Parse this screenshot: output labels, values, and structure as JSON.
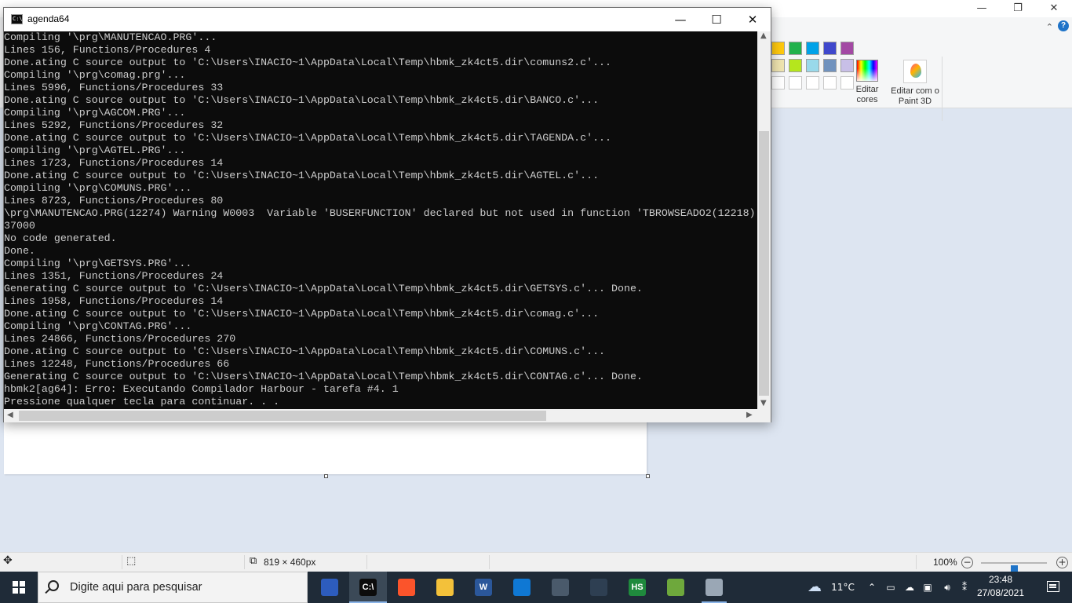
{
  "console": {
    "title": "agenda64",
    "lines": [
      "Compiling '\\prg\\MANUTENCAO.PRG'...",
      "Lines 156, Functions/Procedures 4",
      "Done.ating C source output to 'C:\\Users\\INACIO~1\\AppData\\Local\\Temp\\hbmk_zk4ct5.dir\\comuns2.c'...",
      "Compiling '\\prg\\comag.prg'...",
      "Lines 5996, Functions/Procedures 33",
      "Done.ating C source output to 'C:\\Users\\INACIO~1\\AppData\\Local\\Temp\\hbmk_zk4ct5.dir\\BANCO.c'...",
      "Compiling '\\prg\\AGCOM.PRG'...",
      "Lines 5292, Functions/Procedures 32",
      "Done.ating C source output to 'C:\\Users\\INACIO~1\\AppData\\Local\\Temp\\hbmk_zk4ct5.dir\\TAGENDA.c'...",
      "Compiling '\\prg\\AGTEL.PRG'...",
      "Lines 1723, Functions/Procedures 14",
      "Done.ating C source output to 'C:\\Users\\INACIO~1\\AppData\\Local\\Temp\\hbmk_zk4ct5.dir\\AGTEL.c'...",
      "Compiling '\\prg\\COMUNS.PRG'...",
      "Lines 8723, Functions/Procedures 80",
      "\\prg\\MANUTENCAO.PRG(12274) Warning W0003  Variable 'BUSERFUNCTION' declared but not used in function 'TBROWSEADO2(12218)",
      "37000",
      "No code generated.",
      "Done.",
      "Compiling '\\prg\\GETSYS.PRG'...",
      "Lines 1351, Functions/Procedures 24",
      "Generating C source output to 'C:\\Users\\INACIO~1\\AppData\\Local\\Temp\\hbmk_zk4ct5.dir\\GETSYS.c'... Done.",
      "Lines 1958, Functions/Procedures 14",
      "Done.ating C source output to 'C:\\Users\\INACIO~1\\AppData\\Local\\Temp\\hbmk_zk4ct5.dir\\comag.c'...",
      "Compiling '\\prg\\CONTAG.PRG'...",
      "Lines 24866, Functions/Procedures 270",
      "Done.ating C source output to 'C:\\Users\\INACIO~1\\AppData\\Local\\Temp\\hbmk_zk4ct5.dir\\COMUNS.c'...",
      "Lines 12248, Functions/Procedures 66",
      "Generating C source output to 'C:\\Users\\INACIO~1\\AppData\\Local\\Temp\\hbmk_zk4ct5.dir\\CONTAG.c'... Done.",
      "hbmk2[ag64]: Erro: Executando Compilador Harbour - tarefa #4. 1",
      "Pressione qualquer tecla para continuar. . ."
    ]
  },
  "paint": {
    "ribbon": {
      "edit_colors_label": "Editar cores",
      "paint3d_label": "Editar com o Paint 3D",
      "palette_row1": [
        "#ffc90e",
        "#22b14c",
        "#00a2e8",
        "#3f48cc",
        "#a349a4"
      ],
      "palette_row2": [
        "#efe4b0",
        "#b5e61d",
        "#99d9ea",
        "#7092be",
        "#c8bfe7"
      ]
    },
    "status": {
      "image_size": "819 × 460px",
      "zoom": "100%",
      "zoom_level": 0.5
    }
  },
  "taskbar": {
    "search_placeholder": "Digite aqui para pesquisar",
    "apps": [
      {
        "name": "taskview",
        "glyph": "",
        "color": "#2d5cbd"
      },
      {
        "name": "cmd",
        "glyph": "C:\\",
        "color": "#0c0c0c"
      },
      {
        "name": "brave",
        "glyph": "",
        "color": "#fb542b"
      },
      {
        "name": "explorer",
        "glyph": "",
        "color": "#f3c13a"
      },
      {
        "name": "word",
        "glyph": "W",
        "color": "#2b579a"
      },
      {
        "name": "mail",
        "glyph": "",
        "color": "#0f78d4"
      },
      {
        "name": "calculator",
        "glyph": "",
        "color": "#4a5a6b"
      },
      {
        "name": "snipping",
        "glyph": "",
        "color": "#2e3f52"
      },
      {
        "name": "hs",
        "glyph": "HS",
        "color": "#1f8a3d"
      },
      {
        "name": "chart-app",
        "glyph": "",
        "color": "#6ea83c"
      },
      {
        "name": "paint",
        "glyph": "",
        "color": "#9aa7b5"
      }
    ],
    "weather": "11°C",
    "time": "23:48",
    "date": "27/08/2021"
  }
}
